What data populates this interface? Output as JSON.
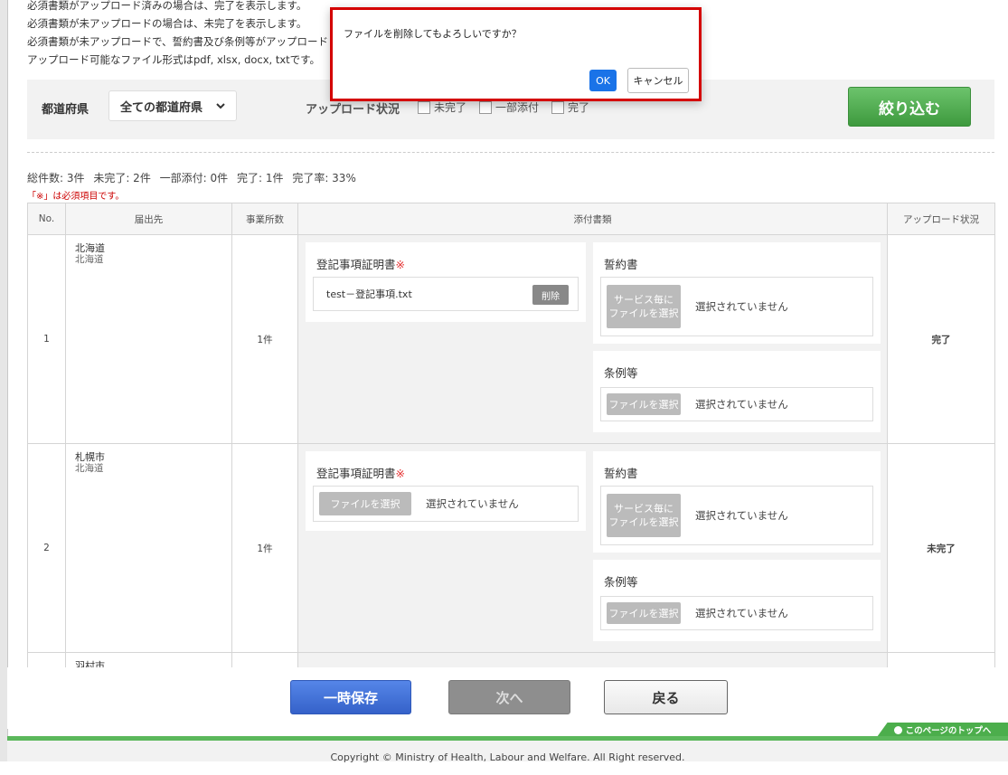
{
  "intro": {
    "lines": [
      "必須書類がアップロード済みの場合は、完了を表示します。",
      "必須書類が未アップロードの場合は、未完了を表示します。",
      "必須書類が未アップロードで、誓約書及び条例等がアップロード",
      "アップロード可能なファイル形式はpdf, xlsx, docx, txtです。"
    ]
  },
  "filter": {
    "pref_label": "都道府県",
    "pref_value": "全ての都道府県",
    "status_label": "アップロード状況",
    "options": [
      "未完了",
      "一部添付",
      "完了"
    ],
    "button": "絞り込む"
  },
  "summary": {
    "total": "総件数: 3件",
    "incomplete": "未完了: 2件",
    "partial": "一部添付: 0件",
    "complete": "完了: 1件",
    "rate": "完了率: 33%"
  },
  "required_note": "「※」は必須項目です。",
  "table": {
    "headers": [
      "No.",
      "届出先",
      "事業所数",
      "添付書類",
      "アップロード状況"
    ],
    "rows": [
      {
        "no": "1",
        "city": "北海道",
        "pref": "北海道",
        "count": "1件",
        "status": "完了",
        "doc1_title": "登記事項証明書",
        "doc1_file": "test－登記事項.txt",
        "doc1_delete": "削除",
        "doc2_title": "誓約書",
        "doc2_btn_line1": "サービス毎に",
        "doc2_btn_line2": "ファイルを選択",
        "doc2_none": "選択されていません",
        "doc3_title": "条例等",
        "doc3_btn": "ファイルを選択",
        "doc3_none": "選択されていません"
      },
      {
        "no": "2",
        "city": "札幌市",
        "pref": "北海道",
        "count": "1件",
        "status": "未完了",
        "doc1_title": "登記事項証明書",
        "doc1_btn": "ファイルを選択",
        "doc1_none": "選択されていません",
        "doc2_title": "誓約書",
        "doc2_btn_line1": "サービス毎に",
        "doc2_btn_line2": "ファイルを選択",
        "doc2_none": "選択されていません",
        "doc3_title": "条例等",
        "doc3_btn": "ファイルを選択",
        "doc3_none": "選択されていません"
      },
      {
        "city": "羽村市"
      }
    ],
    "required_mark": "※"
  },
  "buttons": {
    "save": "一時保存",
    "next": "次へ",
    "back": "戻る"
  },
  "to_top": "このページのトップへ",
  "footer": "Copyright © Ministry of Health, Labour and Welfare. All Right reserved.",
  "dialog": {
    "message": "ファイルを削除してもよろしいですか？",
    "ok": "OK",
    "cancel": "キャンセル"
  },
  "colors": {
    "accent_green": "#4cae4c",
    "save_blue": "#3e6fd8",
    "incomplete_red": "#cc1f1f",
    "dialog_border": "#d40000"
  }
}
